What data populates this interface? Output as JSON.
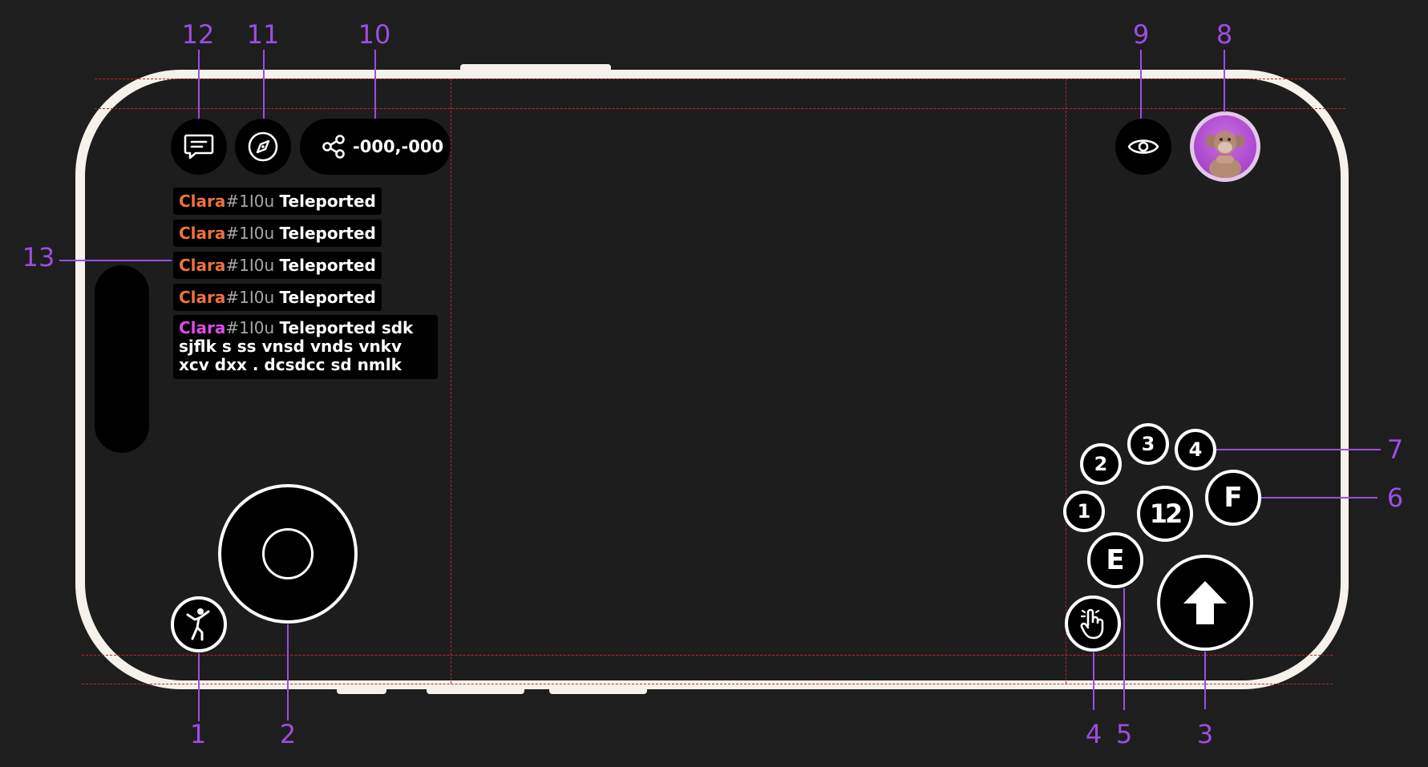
{
  "coordinates": "-000,-000",
  "chat": [
    {
      "name": "Clara",
      "id": "#1I0u",
      "message": "Teleported",
      "name_color": "#f0703c"
    },
    {
      "name": "Clara",
      "id": "#1I0u",
      "message": "Teleported",
      "name_color": "#f0703c"
    },
    {
      "name": "Clara",
      "id": "#1I0u",
      "message": "Teleported",
      "name_color": "#f0703c"
    },
    {
      "name": "Clara",
      "id": "#1I0u",
      "message": "Teleported",
      "name_color": "#f0703c"
    },
    {
      "name": "Clara",
      "id": "#1I0u",
      "message": "Teleported sdk sjflk s ss vnsd vnds vnkv xcv dxx . dcsdcc sd nmlk",
      "name_color": "#e04ae8"
    }
  ],
  "action_keys": {
    "slot_1": "1",
    "slot_2": "2",
    "slot_3": "3",
    "slot_4": "4",
    "slot_combo": "12",
    "key_e": "E",
    "key_f": "F"
  },
  "callouts": [
    "1",
    "2",
    "3",
    "4",
    "5",
    "6",
    "7",
    "8",
    "9",
    "10",
    "11",
    "12",
    "13"
  ],
  "icons": {
    "chat": "chat-bubble-icon",
    "map": "compass-icon",
    "share": "share-icon",
    "view": "eye-icon",
    "emote": "dance-icon",
    "pointer": "hand-pointer-icon",
    "jump": "arrow-up-icon"
  },
  "colors": {
    "callout": "#9b4fe0",
    "guide": "#b8282c",
    "phone_frame": "#f6f1eb",
    "screen": "#1d1d1e",
    "avatar_ring": "#b04ad8"
  }
}
